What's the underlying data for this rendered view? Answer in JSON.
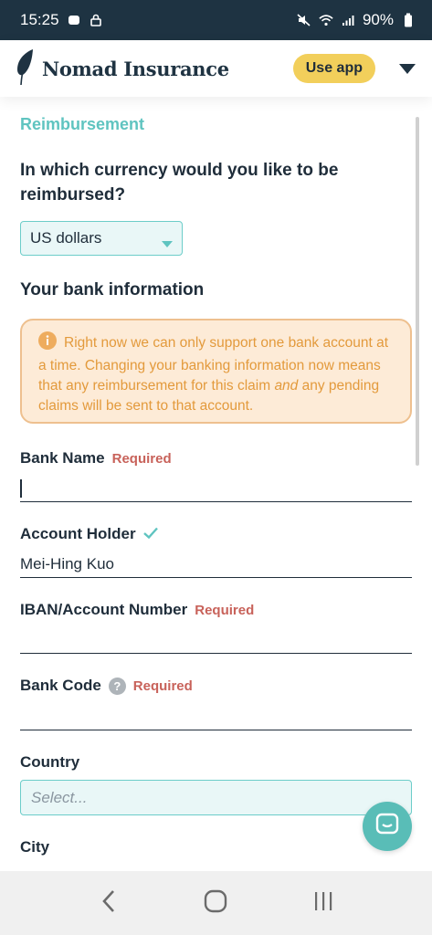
{
  "status_bar": {
    "time": "15:25",
    "battery": "90%"
  },
  "header": {
    "brand_name": "Nomad Insurance",
    "use_app_label": "Use app"
  },
  "form": {
    "section_title": "Reimbursement",
    "currency_question": "In which currency would you like to be reimbursed?",
    "currency_value": "US dollars",
    "bank_heading": "Your bank information",
    "notice": {
      "text_before": "Right now we can only support one bank account at a time. Changing your banking information now means that any reimbursement for this claim ",
      "emphasis": "and",
      "text_after": " any pending claims will be sent to that account."
    },
    "required_label": "Required",
    "fields": {
      "bank_name": {
        "label": "Bank Name",
        "value": ""
      },
      "account_holder": {
        "label": "Account Holder",
        "value": "Mei-Hing Kuo"
      },
      "iban": {
        "label": "IBAN/Account Number",
        "value": ""
      },
      "bank_code": {
        "label": "Bank Code",
        "value": ""
      },
      "country": {
        "label": "Country",
        "placeholder": "Select..."
      },
      "city": {
        "label": "City"
      }
    }
  },
  "colors": {
    "accent_teal": "#5fc4c0",
    "use_app_yellow": "#f2cf5b",
    "required_red": "#c8625a",
    "notice_orange": "#e39a3c",
    "status_bar_bg": "#1e3342"
  },
  "icons": [
    "mute-icon",
    "wifi-icon",
    "signal-icon",
    "battery-icon",
    "lock-icon",
    "photo-icon",
    "feather-logo-icon",
    "chevron-down-icon",
    "info-icon",
    "check-icon",
    "help-icon",
    "chat-icon",
    "back-icon",
    "home-icon",
    "recents-icon"
  ]
}
